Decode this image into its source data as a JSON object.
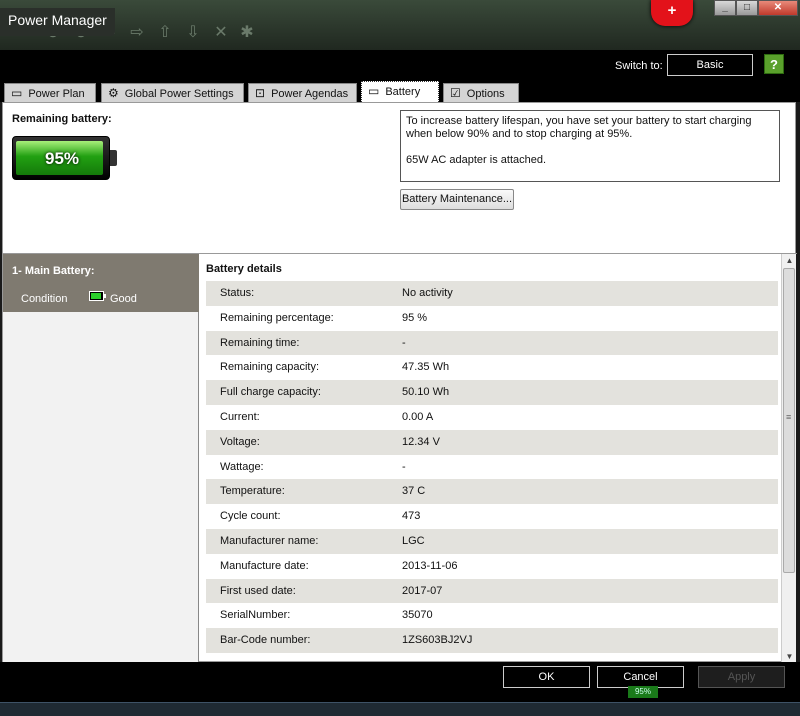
{
  "window": {
    "title": "Power Manager",
    "logo_glyph": "+",
    "controls": {
      "minimize": "_",
      "maximize": "□",
      "close": "✕"
    }
  },
  "header": {
    "switch_label": "Switch to:",
    "switch_button": "Basic",
    "help_glyph": "?"
  },
  "tabs": [
    {
      "label": "Power Plan",
      "icon": "document-icon",
      "glyph": "▭"
    },
    {
      "label": "Global Power Settings",
      "icon": "gear-icon",
      "glyph": "⚙"
    },
    {
      "label": "Power Agendas",
      "icon": "clock-icon",
      "glyph": "⊡"
    },
    {
      "label": "Battery",
      "icon": "battery-icon",
      "glyph": "▭",
      "active": true
    },
    {
      "label": "Options",
      "icon": "checkbox-icon",
      "glyph": "☑"
    }
  ],
  "battery": {
    "remaining_label": "Remaining battery:",
    "percent_text": "95%",
    "level_fraction": 0.95,
    "fill_color": "#22a012"
  },
  "info": {
    "line1": "To increase battery lifespan, you have set your battery to start charging when below 90% and to stop charging at 95%.",
    "line2": "65W AC adapter is attached."
  },
  "maintenance_button": "Battery Maintenance...",
  "battery_list": {
    "item_name": "1- Main Battery:",
    "condition_label": "Condition",
    "condition_value": "Good"
  },
  "details": {
    "title": "Battery details",
    "rows": [
      {
        "key": "Status:",
        "value": "No activity"
      },
      {
        "key": "Remaining percentage:",
        "value": "95 %"
      },
      {
        "key": "Remaining time:",
        "value": "-"
      },
      {
        "key": "Remaining capacity:",
        "value": "47.35 Wh"
      },
      {
        "key": "Full charge capacity:",
        "value": "50.10 Wh"
      },
      {
        "key": "Current:",
        "value": "0.00 A"
      },
      {
        "key": "Voltage:",
        "value": "12.34 V"
      },
      {
        "key": "Wattage:",
        "value": "-"
      },
      {
        "key": "Temperature:",
        "value": "37 C"
      },
      {
        "key": "Cycle count:",
        "value": "473"
      },
      {
        "key": "Manufacturer name:",
        "value": "LGC"
      },
      {
        "key": "Manufacture date:",
        "value": "2013-11-06"
      },
      {
        "key": "First used date:",
        "value": "2017-07"
      },
      {
        "key": "SerialNumber:",
        "value": "35070"
      },
      {
        "key": "Bar-Code number:",
        "value": "1ZS603BJ2VJ"
      }
    ]
  },
  "footer": {
    "ok": "OK",
    "cancel": "Cancel",
    "apply": "Apply",
    "tray_battery": "95%"
  }
}
